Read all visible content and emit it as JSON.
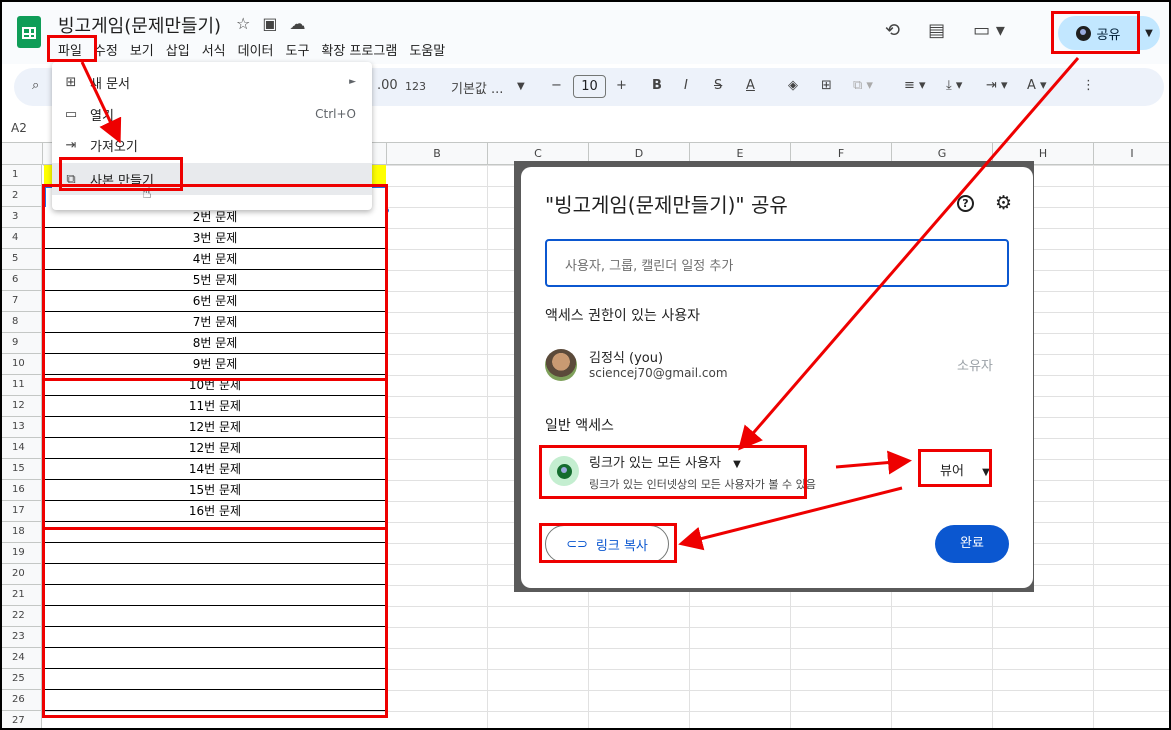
{
  "header": {
    "doc_title": "빙고게임(문제만들기)",
    "menu": [
      "파일",
      "수정",
      "보기",
      "삽입",
      "서식",
      "데이터",
      "도구",
      "확장 프로그램",
      "도움말"
    ],
    "share_label": "공유"
  },
  "toolbar": {
    "decimal": ".00",
    "number_format": "123",
    "font": "기본값 ...",
    "font_size": "10"
  },
  "name_box": "A2",
  "columns": [
    "B",
    "C",
    "D",
    "E",
    "F",
    "G",
    "H",
    "I"
  ],
  "rows": [
    "1",
    "2",
    "3",
    "4",
    "5",
    "6",
    "7",
    "8",
    "9",
    "10",
    "11",
    "12",
    "13",
    "14",
    "15",
    "16",
    "17",
    "18",
    "19",
    "20",
    "21",
    "22",
    "23",
    "24",
    "25",
    "26",
    "27"
  ],
  "cells": [
    "2번 문제",
    "3번 문제",
    "4번 문제",
    "5번 문제",
    "6번 문제",
    "7번 문제",
    "8번 문제",
    "9번 문제",
    "10번 문제",
    "11번 문제",
    "12번 문제",
    "12번 문제",
    "14번 문제",
    "15번 문제",
    "16번 문제"
  ],
  "file_menu": {
    "items": [
      {
        "label": "새 문서",
        "shortcut": "►"
      },
      {
        "label": "열기",
        "shortcut": "Ctrl+O"
      },
      {
        "label": "가져오기",
        "shortcut": ""
      },
      {
        "label": "사본 만들기",
        "shortcut": ""
      }
    ]
  },
  "share_dialog": {
    "title": "\"빙고게임(문제만들기)\" 공유",
    "input_placeholder": "사용자, 그룹, 캘린더 일정 추가",
    "access_heading": "액세스 권한이 있는 사용자",
    "user_name": "김정식 (you)",
    "user_email": "sciencej70@gmail.com",
    "owner_label": "소유자",
    "general_heading": "일반 액세스",
    "general_label": "링크가 있는 모든 사용자",
    "general_desc": "링크가 있는 인터넷상의 모든 사용자가 볼 수 있음",
    "role": "뷰어",
    "copy_link": "링크 복사",
    "done": "완료"
  },
  "colors": {
    "accent": "#0b57d0",
    "annotation": "#e00000",
    "share_bg": "#c2e7ff"
  }
}
